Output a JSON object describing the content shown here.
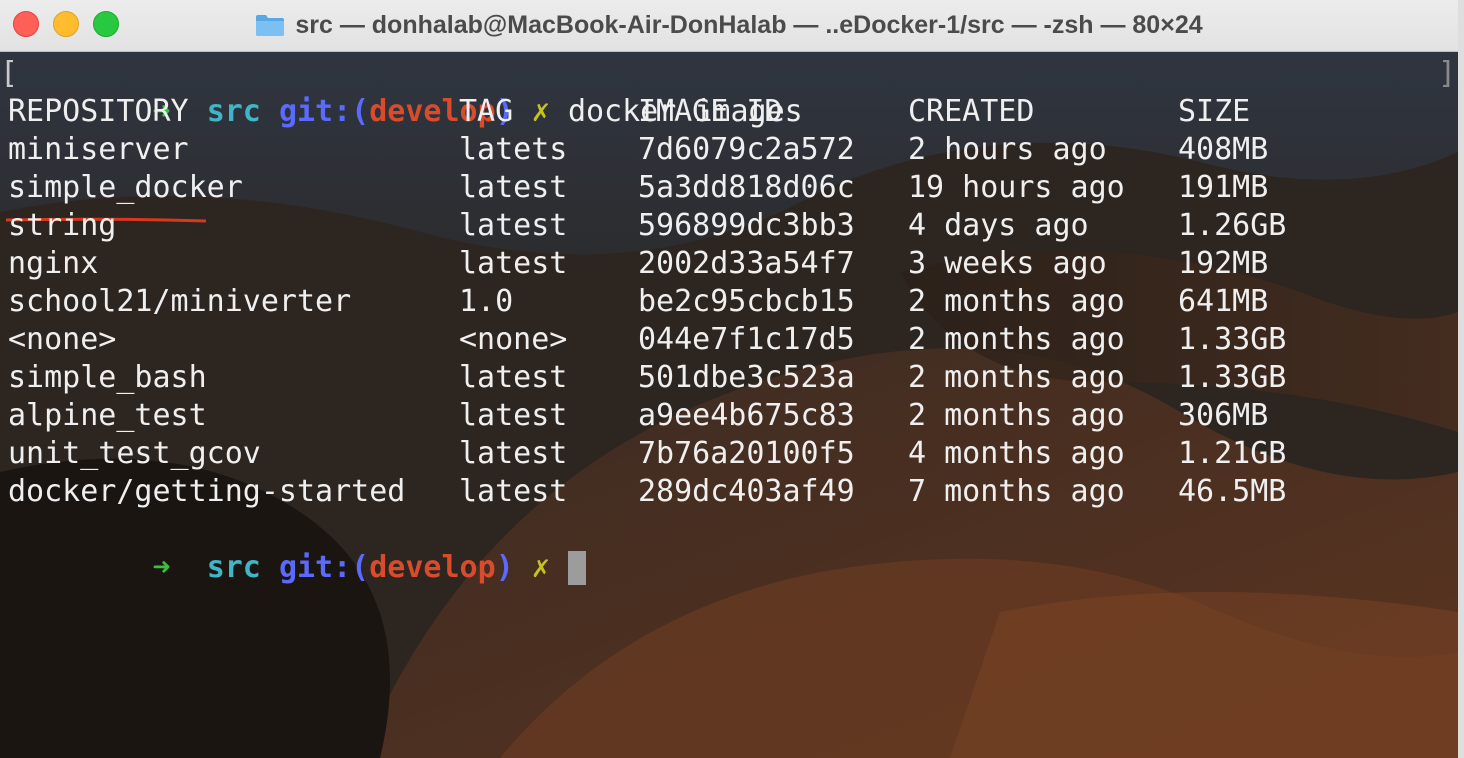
{
  "window": {
    "title": "src — donhalab@MacBook-Air-DonHalab — ..eDocker-1/src — -zsh — 80×24",
    "icon": "folder-icon"
  },
  "prompt": {
    "arrow": "➜",
    "dir": "src",
    "git_prefix": "git:(",
    "branch": "develop",
    "git_suffix": ")",
    "dirty_mark": "✗"
  },
  "command": "docker images",
  "table": {
    "headers": [
      "REPOSITORY",
      "TAG",
      "IMAGE ID",
      "CREATED",
      "SIZE"
    ],
    "rows": [
      [
        "miniserver",
        "latets",
        "7d6079c2a572",
        "2 hours ago",
        "408MB"
      ],
      [
        "simple_docker",
        "latest",
        "5a3dd818d06c",
        "19 hours ago",
        "191MB"
      ],
      [
        "string",
        "latest",
        "596899dc3bb3",
        "4 days ago",
        "1.26GB"
      ],
      [
        "nginx",
        "latest",
        "2002d33a54f7",
        "3 weeks ago",
        "192MB"
      ],
      [
        "school21/miniverter",
        "1.0",
        "be2c95cbcb15",
        "2 months ago",
        "641MB"
      ],
      [
        "<none>",
        "<none>",
        "044e7f1c17d5",
        "2 months ago",
        "1.33GB"
      ],
      [
        "simple_bash",
        "latest",
        "501dbe3c523a",
        "2 months ago",
        "1.33GB"
      ],
      [
        "alpine_test",
        "latest",
        "a9ee4b675c83",
        "2 months ago",
        "306MB"
      ],
      [
        "unit_test_gcov",
        "latest",
        "7b76a20100f5",
        "4 months ago",
        "1.21GB"
      ],
      [
        "docker/getting-started",
        "latest",
        "289dc403af49",
        "7 months ago",
        "46.5MB"
      ]
    ]
  },
  "colors": {
    "arrow": "#39c13a",
    "dir": "#3fb5c7",
    "git": "#5a6aff",
    "branch": "#d94b2b",
    "dirty_mark": "#c5c21d",
    "annotation": "#d9381e"
  }
}
